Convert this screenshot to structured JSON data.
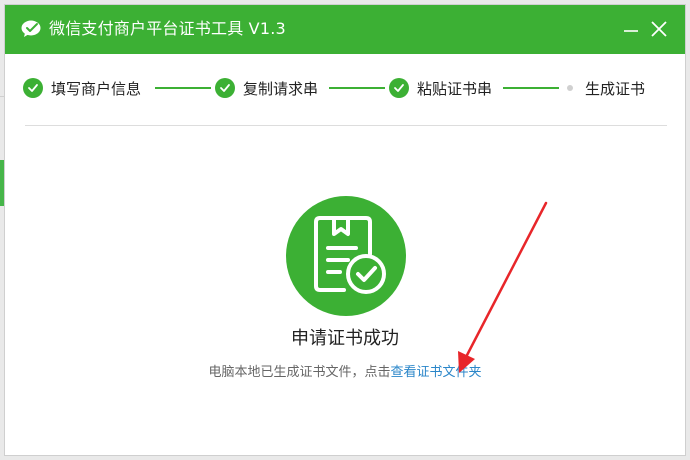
{
  "window": {
    "title": "微信支付商户平台证书工具 V1.3"
  },
  "steps": [
    {
      "label": "填写商户信息",
      "status": "done"
    },
    {
      "label": "复制请求串",
      "status": "done"
    },
    {
      "label": "粘贴证书串",
      "status": "done"
    },
    {
      "label": "生成证书",
      "status": "current"
    }
  ],
  "result": {
    "title": "申请证书成功",
    "hint_text": "电脑本地已生成证书文件，点击",
    "link_text": "查看证书文件夹"
  },
  "colors": {
    "accent": "#3cb034",
    "link": "#2a86c9",
    "annotation_arrow": "#e8262a"
  },
  "icons": {
    "logo": "wechat-logo-icon",
    "minimize": "minimize-icon",
    "close": "close-icon",
    "step_done": "checkmark-icon",
    "success": "certificate-check-icon"
  }
}
